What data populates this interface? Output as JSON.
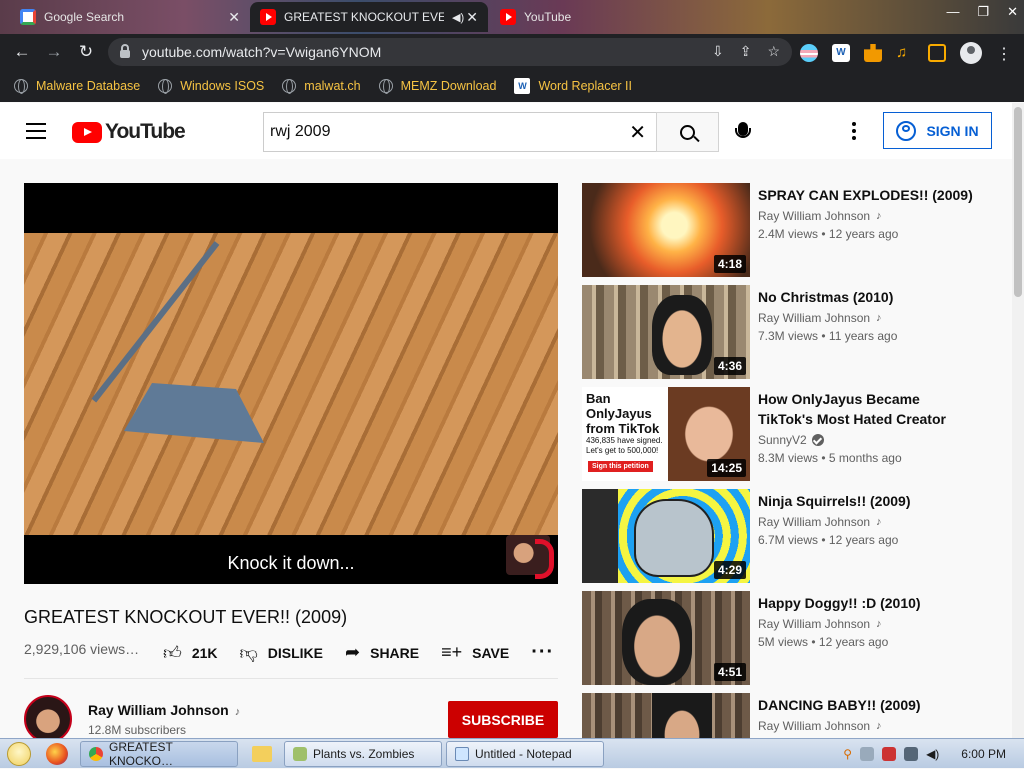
{
  "browser": {
    "tabs": [
      {
        "label": "Google Search",
        "active": false
      },
      {
        "label": "GREATEST KNOCKOUT EVER",
        "active": true
      },
      {
        "label": "YouTube",
        "active": false
      }
    ],
    "url": "youtube.com/watch?v=Vwigan6YNOM",
    "bookmarks": [
      "Malware Database",
      "Windows ISOS",
      "malwat.ch",
      "MEMZ Download",
      "Word Replacer II"
    ],
    "extension_icons": [
      "trans-flag-icon",
      "word-replacer-icon",
      "puzzle-icon",
      "media-icon",
      "sidebar-icon",
      "profile-icon",
      "menu-icon"
    ]
  },
  "youtube": {
    "logo_text": "YouTube",
    "search": {
      "value": "rwj 2009",
      "placeholder": "Search"
    },
    "sign_in_label": "SIGN IN",
    "player": {
      "caption": "Knock it down..."
    },
    "video": {
      "title": "GREATEST KNOCKOUT EVER!! (2009)",
      "views": "2,929,106 views…",
      "likes": "21K",
      "dislike_label": "DISLIKE",
      "share_label": "SHARE",
      "save_label": "SAVE"
    },
    "owner": {
      "name": "Ray William Johnson",
      "subscribers": "12.8M subscribers",
      "subscribe_label": "SUBSCRIBE"
    },
    "related": [
      {
        "title": "SPRAY CAN EXPLODES!! (2009)",
        "channel": "Ray William Johnson",
        "channel_mark": "note",
        "views": "2.4M views",
        "age": "12 years ago",
        "duration": "4:18"
      },
      {
        "title": "No Christmas (2010)",
        "channel": "Ray William Johnson",
        "channel_mark": "note",
        "views": "7.3M views",
        "age": "11 years ago",
        "duration": "4:36"
      },
      {
        "title": "How OnlyJayus Became TikTok's Most Hated Creator",
        "channel": "SunnyV2",
        "channel_mark": "verified",
        "views": "8.3M views",
        "age": "5 months ago",
        "duration": "14:25",
        "thumb_text": {
          "line1": "Ban OnlyJayus",
          "line2": "from TikTok",
          "line3": "436,835 have signed.",
          "line4": "Let's get to 500,000!",
          "button": "Sign this petition"
        }
      },
      {
        "title": "Ninja Squirrels!! (2009)",
        "channel": "Ray William Johnson",
        "channel_mark": "note",
        "views": "6.7M views",
        "age": "12 years ago",
        "duration": "4:29"
      },
      {
        "title": "Happy Doggy!! :D (2010)",
        "channel": "Ray William Johnson",
        "channel_mark": "note",
        "views": "5M views",
        "age": "12 years ago",
        "duration": "4:51"
      },
      {
        "title": "DANCING BABY!! (2009)",
        "channel": "Ray William Johnson",
        "channel_mark": "note",
        "views": "",
        "age": "",
        "duration": ""
      }
    ]
  },
  "taskbar": {
    "buttons": [
      {
        "label": "GREATEST KNOCKO…",
        "active": true
      },
      {
        "label": "Plants vs. Zombies",
        "active": false
      },
      {
        "label": "Untitled - Notepad",
        "active": false
      }
    ],
    "clock": "6:00 PM"
  },
  "colors": {
    "youtube_red": "#ff0000",
    "subscribe_red": "#cc0000",
    "signin_blue": "#065fd4",
    "bookmark_text": "#f6c343",
    "chrome_dark": "#202124"
  }
}
